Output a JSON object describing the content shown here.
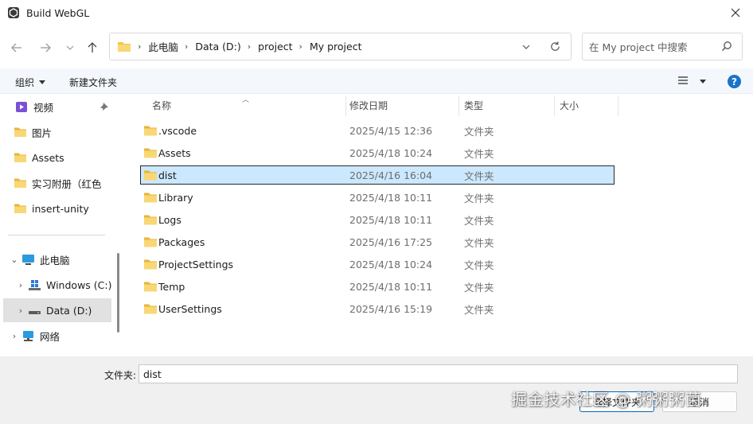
{
  "window": {
    "title": "Build WebGL"
  },
  "address": {
    "root": "此电脑",
    "crumbs": [
      "Data (D:)",
      "project",
      "My project"
    ]
  },
  "search": {
    "placeholder": "在 My project 中搜索"
  },
  "toolbar": {
    "organize": "组织",
    "new_folder": "新建文件夹"
  },
  "sidebar": {
    "quick": [
      {
        "label": "视频",
        "icon": "video-folder-icon"
      },
      {
        "label": "图片",
        "icon": "folder-icon"
      },
      {
        "label": "Assets",
        "icon": "folder-icon"
      },
      {
        "label": "实习附册（红色",
        "icon": "folder-icon"
      },
      {
        "label": "insert-unity",
        "icon": "folder-icon"
      }
    ],
    "this_pc": "此电脑",
    "drives": [
      {
        "label": "Windows (C:)",
        "icon": "windows-drive-icon"
      },
      {
        "label": "Data (D:)",
        "icon": "drive-icon"
      }
    ],
    "network": "网络"
  },
  "columns": {
    "name": "名称",
    "date": "修改日期",
    "type": "类型",
    "size": "大小"
  },
  "files": [
    {
      "name": ".vscode",
      "date": "2025/4/15 12:36",
      "type": "文件夹"
    },
    {
      "name": "Assets",
      "date": "2025/4/18 10:24",
      "type": "文件夹"
    },
    {
      "name": "dist",
      "date": "2025/4/16 16:04",
      "type": "文件夹",
      "selected": true
    },
    {
      "name": "Library",
      "date": "2025/4/18 10:11",
      "type": "文件夹"
    },
    {
      "name": "Logs",
      "date": "2025/4/18 10:11",
      "type": "文件夹"
    },
    {
      "name": "Packages",
      "date": "2025/4/16 17:25",
      "type": "文件夹"
    },
    {
      "name": "ProjectSettings",
      "date": "2025/4/18 10:24",
      "type": "文件夹"
    },
    {
      "name": "Temp",
      "date": "2025/4/18 10:11",
      "type": "文件夹"
    },
    {
      "name": "UserSettings",
      "date": "2025/4/16 15:19",
      "type": "文件夹"
    }
  ],
  "footer": {
    "folder_label": "文件夹:",
    "folder_value": "dist",
    "select_button": "选择文件夹",
    "cancel_button": "取消"
  },
  "watermark": "掘金技术社区 @ 粥粥粥菌",
  "colors": {
    "accent": "#0067c0",
    "selection": "#cce8ff",
    "folder": "#f3c64b"
  }
}
